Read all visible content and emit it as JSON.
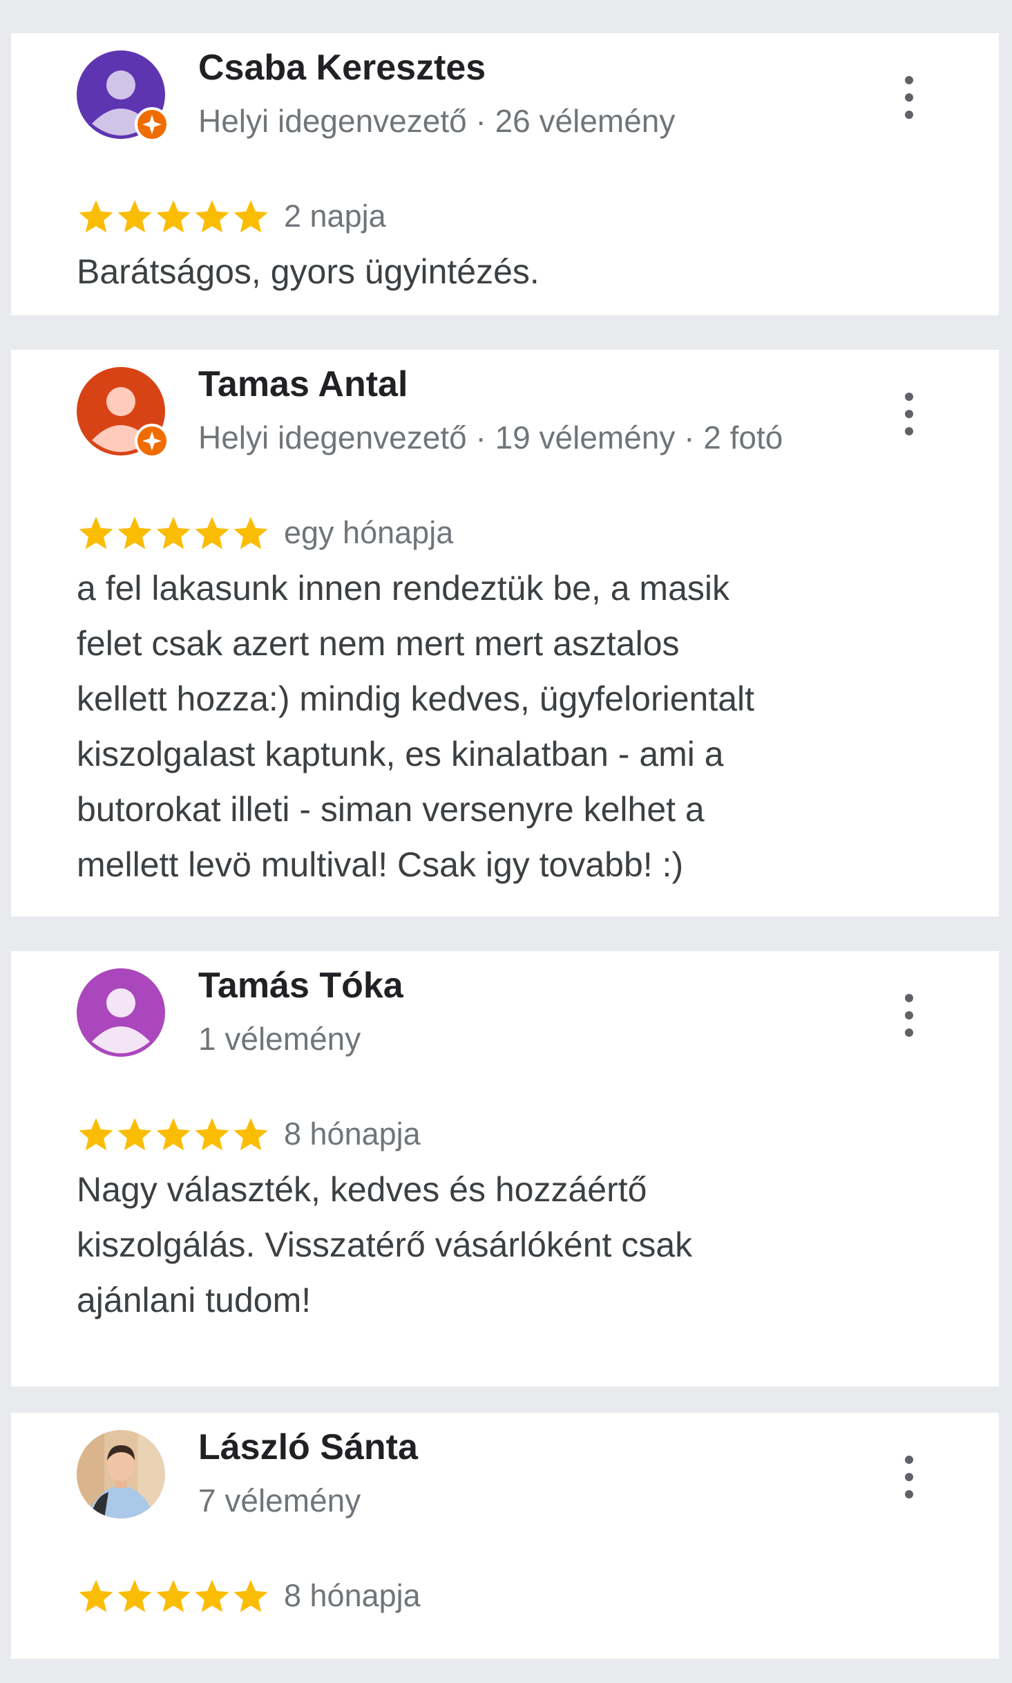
{
  "reviews": [
    {
      "name": "Csaba Keresztes",
      "meta": "Helyi idegenvezető · 26 vélemény",
      "rating": 5,
      "when": "2 napja",
      "text_lines": [
        "Barátságos, gyors ügyintézés."
      ],
      "avatar_color": "#5e35b1",
      "local_guide": true
    },
    {
      "name": "Tamas Antal",
      "meta": "Helyi idegenvezető · 19 vélemény · 2 fotó",
      "rating": 5,
      "when": "egy hónapja",
      "text_lines": [
        "a fel lakasunk innen rendeztük be, a masik",
        "felet csak azert nem mert mert asztalos",
        "kellett hozza:) mindig kedves, ügyfelorientalt",
        "kiszolgalast kaptunk, es kinalatban - ami a",
        "butorokat illeti - siman versenyre kelhet a",
        "mellett levö multival! Csak igy tovabb! :)"
      ],
      "avatar_color": "#d84315",
      "local_guide": true
    },
    {
      "name": "Tamás Tóka",
      "meta": "1 vélemény",
      "rating": 5,
      "when": "8 hónapja",
      "text_lines": [
        "Nagy választék, kedves és hozzáértő",
        "kiszolgálás. Visszatérő vásárlóként csak",
        "ajánlani tudom!"
      ],
      "avatar_color": "#ab47bc",
      "local_guide": false
    },
    {
      "name": "László Sánta",
      "meta": "7 vélemény",
      "rating": 5,
      "when": "8 hónapja",
      "text_lines": [],
      "avatar_color": "#c8a27c",
      "local_guide": false
    }
  ],
  "icons": {
    "star": "star-icon",
    "more": "more-vert-icon",
    "badge": "local-guide-badge-icon",
    "avatar": "default-avatar-icon"
  },
  "colors": {
    "star": "#fbbc04",
    "badge": "#ef6c00",
    "name": "#202124",
    "meta": "#70757a",
    "text": "#3c4043",
    "background": "#e8eaed"
  }
}
